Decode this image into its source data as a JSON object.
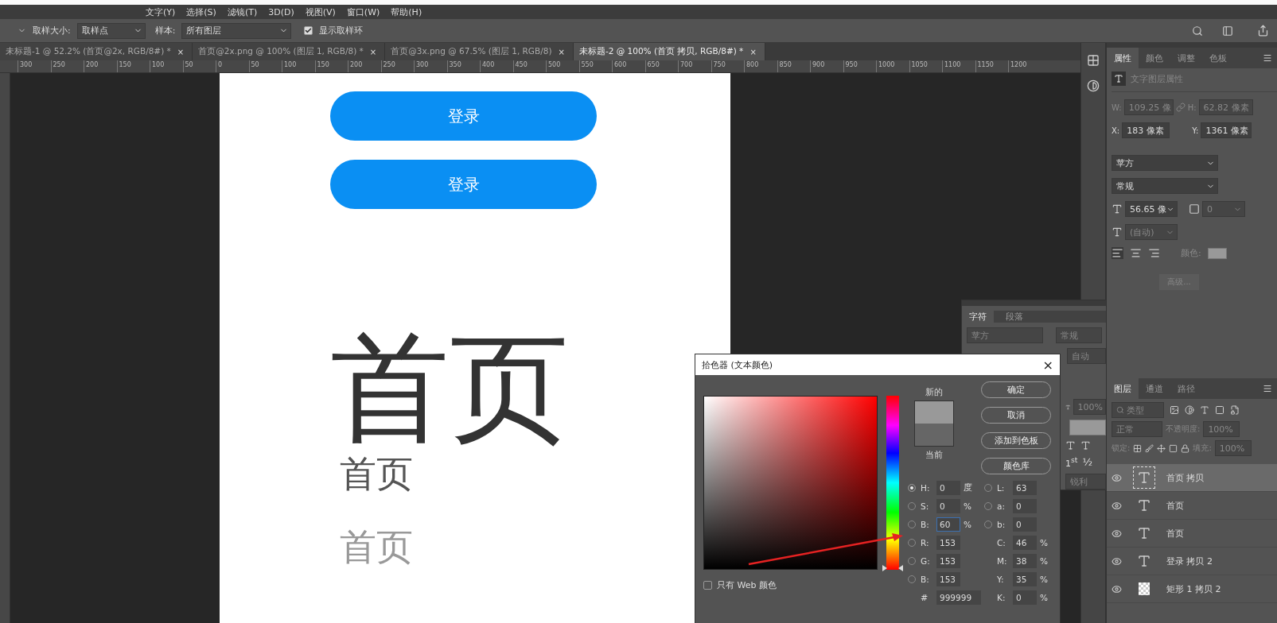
{
  "menu_bar": {
    "items": [
      "文字(Y)",
      "选择(S)",
      "滤镜(T)",
      "3D(D)",
      "视图(V)",
      "窗口(W)",
      "帮助(H)"
    ]
  },
  "options_bar": {
    "sample_size_label": "取样大小:",
    "sample_size": "取样点",
    "sample_label": "样本:",
    "sample": "所有图层",
    "show_ring": {
      "label": "显示取样环",
      "checked": true
    }
  },
  "doc_tabs": [
    {
      "label": "未标题-1 @ 52.2% (首页@2x, RGB/8#) *",
      "close": "×",
      "selected": false
    },
    {
      "label": "首页@2x.png @ 100% (图层 1, RGB/8) *",
      "close": "×",
      "selected": false
    },
    {
      "label": "首页@3x.png @ 67.5% (图层 1, RGB/8)",
      "close": "×",
      "selected": false
    },
    {
      "label": "未标题-2 @ 100% (首页 拷贝, RGB/8#) *",
      "close": "×",
      "selected": true
    }
  ],
  "ruler_ticks": [
    "300",
    "250",
    "200",
    "150",
    "100",
    "50",
    "0",
    "50",
    "100",
    "150",
    "200",
    "250",
    "300",
    "350",
    "400",
    "450",
    "500",
    "550",
    "600",
    "650",
    "700",
    "750",
    "800",
    "850",
    "900",
    "950",
    "1000",
    "1050",
    "1100",
    "1150",
    "1200"
  ],
  "canvas": {
    "buttons": [
      "登录",
      "登录"
    ],
    "headings": [
      {
        "text": "首页",
        "kind": "large",
        "color": "#333333"
      },
      {
        "text": "首页",
        "kind": "medium",
        "color": "#555555"
      },
      {
        "text": "首页",
        "kind": "medium",
        "color": "#999999"
      }
    ]
  },
  "properties_panel": {
    "tabs": [
      {
        "label": "属性",
        "selected": true
      },
      {
        "label": "颜色",
        "selected": false
      },
      {
        "label": "调整",
        "selected": false
      },
      {
        "label": "色板",
        "selected": false
      }
    ],
    "section_title": "文字图层属性",
    "w_label": "W:",
    "w": "109.25 像",
    "h_label": "H:",
    "h": "62.82 像素",
    "x_label": "X:",
    "x": "183 像素",
    "y_label": "Y:",
    "y": "1361 像素",
    "font": "苹方",
    "style": "常规",
    "size": "56.65 像",
    "tracking": "0",
    "leading": "(自动)",
    "color_label": "颜色:",
    "advanced": "高级..."
  },
  "character_panel": {
    "tabs": [
      {
        "label": "字符",
        "selected": true
      },
      {
        "label": "段落",
        "selected": false
      }
    ],
    "font": "苹方",
    "style": "常规",
    "leading": "自动",
    "scale": "100%",
    "ordinal": "1$^{st}$",
    "fraction": "½",
    "antialias": "锐利"
  },
  "layers_panel": {
    "tabs": [
      {
        "label": "图层",
        "selected": true
      },
      {
        "label": "通道",
        "selected": false
      },
      {
        "label": "路径",
        "selected": false
      }
    ],
    "filter_placeholder": "类型",
    "blend_mode": "正常",
    "opacity_label": "不透明度:",
    "opacity": "100%",
    "lock_label": "锁定:",
    "fill_label": "填充:",
    "fill": "100%",
    "layers": [
      {
        "name": "首页 拷贝",
        "kind": "text",
        "selected": true
      },
      {
        "name": "首页",
        "kind": "text",
        "selected": false
      },
      {
        "name": "首页",
        "kind": "text",
        "selected": false
      },
      {
        "name": "登录 拷贝 2",
        "kind": "text",
        "selected": false
      },
      {
        "name": "矩形 1 拷贝 2",
        "kind": "shape",
        "selected": false
      }
    ]
  },
  "color_picker": {
    "title": "拾色器 (文本颜色)",
    "close": "×",
    "new_label": "新的",
    "current_label": "当前",
    "buttons": [
      "确定",
      "取消",
      "添加到色板",
      "颜色库"
    ],
    "web_only": {
      "label": "只有 Web 颜色",
      "checked": false
    },
    "hue": {
      "level": 0
    },
    "left_fields": [
      {
        "kind": "radio",
        "label": "H:",
        "value": "0",
        "unit": "度",
        "selected": true,
        "focused": false
      },
      {
        "kind": "radio",
        "label": "S:",
        "value": "0",
        "unit": "%",
        "selected": false,
        "focused": false
      },
      {
        "kind": "radio",
        "label": "B:",
        "value": "60",
        "unit": "%",
        "selected": false,
        "focused": true
      },
      {
        "kind": "radio",
        "label": "R:",
        "value": "153",
        "selected": false,
        "focused": false
      },
      {
        "kind": "radio",
        "label": "G:",
        "value": "153",
        "selected": false,
        "focused": false
      },
      {
        "kind": "radio",
        "label": "B:",
        "value": "153",
        "selected": false,
        "focused": false
      },
      {
        "kind": "plain",
        "label": "#",
        "value": "999999",
        "focused": false
      }
    ],
    "right_fields": [
      {
        "kind": "radio",
        "label": "L:",
        "value": "63",
        "selected": false
      },
      {
        "kind": "radio",
        "label": "a:",
        "value": "0",
        "selected": false
      },
      {
        "kind": "radio",
        "label": "b:",
        "value": "0",
        "selected": false
      },
      {
        "kind": "plain",
        "label": "C:",
        "value": "46",
        "unit": "%"
      },
      {
        "kind": "plain",
        "label": "M:",
        "value": "38",
        "unit": "%"
      },
      {
        "kind": "plain",
        "label": "Y:",
        "value": "35",
        "unit": "%"
      },
      {
        "kind": "plain",
        "label": "K:",
        "value": "0",
        "unit": "%"
      }
    ]
  }
}
